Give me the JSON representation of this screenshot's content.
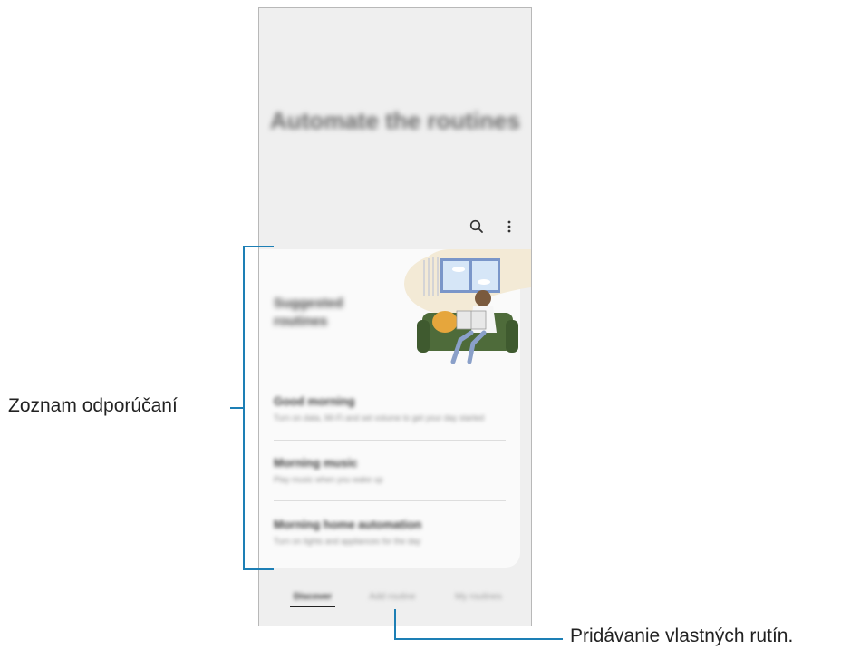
{
  "callouts": {
    "recommendations": "Zoznam odporúčaní",
    "add_custom": "Pridávanie vlastných rutín."
  },
  "header": {
    "title": "Automate the routines",
    "search_icon": "search-icon",
    "more_icon": "more-options-icon"
  },
  "card": {
    "title": "Suggested routines"
  },
  "list": [
    {
      "title": "Good morning",
      "subtitle": "Turn on data, Wi-Fi and set volume to get your day started"
    },
    {
      "title": "Morning music",
      "subtitle": "Play music when you wake up"
    },
    {
      "title": "Morning home automation",
      "subtitle": "Turn on lights and appliances for the day"
    }
  ],
  "tabs": [
    "Discover",
    "Add routine",
    "My routines"
  ],
  "colors": {
    "accent_line": "#1d7fb5",
    "sofa": "#4e6b3a",
    "window": "#7a96c9"
  }
}
